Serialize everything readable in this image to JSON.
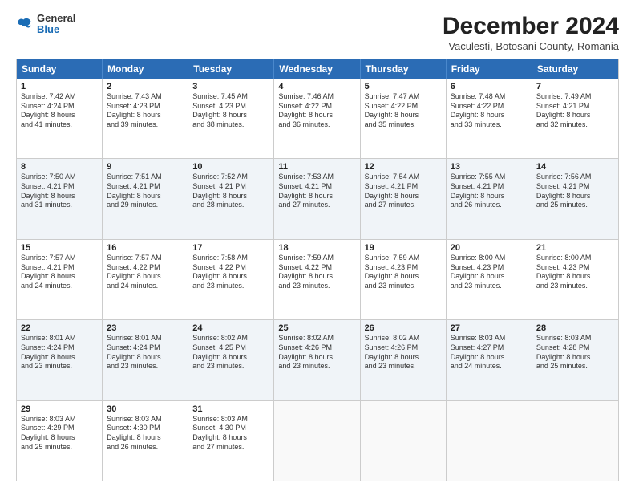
{
  "header": {
    "logo_general": "General",
    "logo_blue": "Blue",
    "month_title": "December 2024",
    "subtitle": "Vaculesti, Botosani County, Romania"
  },
  "days_of_week": [
    "Sunday",
    "Monday",
    "Tuesday",
    "Wednesday",
    "Thursday",
    "Friday",
    "Saturday"
  ],
  "rows": [
    [
      {
        "day": "1",
        "lines": [
          "Sunrise: 7:42 AM",
          "Sunset: 4:24 PM",
          "Daylight: 8 hours",
          "and 41 minutes."
        ]
      },
      {
        "day": "2",
        "lines": [
          "Sunrise: 7:43 AM",
          "Sunset: 4:23 PM",
          "Daylight: 8 hours",
          "and 39 minutes."
        ]
      },
      {
        "day": "3",
        "lines": [
          "Sunrise: 7:45 AM",
          "Sunset: 4:23 PM",
          "Daylight: 8 hours",
          "and 38 minutes."
        ]
      },
      {
        "day": "4",
        "lines": [
          "Sunrise: 7:46 AM",
          "Sunset: 4:22 PM",
          "Daylight: 8 hours",
          "and 36 minutes."
        ]
      },
      {
        "day": "5",
        "lines": [
          "Sunrise: 7:47 AM",
          "Sunset: 4:22 PM",
          "Daylight: 8 hours",
          "and 35 minutes."
        ]
      },
      {
        "day": "6",
        "lines": [
          "Sunrise: 7:48 AM",
          "Sunset: 4:22 PM",
          "Daylight: 8 hours",
          "and 33 minutes."
        ]
      },
      {
        "day": "7",
        "lines": [
          "Sunrise: 7:49 AM",
          "Sunset: 4:21 PM",
          "Daylight: 8 hours",
          "and 32 minutes."
        ]
      }
    ],
    [
      {
        "day": "8",
        "lines": [
          "Sunrise: 7:50 AM",
          "Sunset: 4:21 PM",
          "Daylight: 8 hours",
          "and 31 minutes."
        ]
      },
      {
        "day": "9",
        "lines": [
          "Sunrise: 7:51 AM",
          "Sunset: 4:21 PM",
          "Daylight: 8 hours",
          "and 29 minutes."
        ]
      },
      {
        "day": "10",
        "lines": [
          "Sunrise: 7:52 AM",
          "Sunset: 4:21 PM",
          "Daylight: 8 hours",
          "and 28 minutes."
        ]
      },
      {
        "day": "11",
        "lines": [
          "Sunrise: 7:53 AM",
          "Sunset: 4:21 PM",
          "Daylight: 8 hours",
          "and 27 minutes."
        ]
      },
      {
        "day": "12",
        "lines": [
          "Sunrise: 7:54 AM",
          "Sunset: 4:21 PM",
          "Daylight: 8 hours",
          "and 27 minutes."
        ]
      },
      {
        "day": "13",
        "lines": [
          "Sunrise: 7:55 AM",
          "Sunset: 4:21 PM",
          "Daylight: 8 hours",
          "and 26 minutes."
        ]
      },
      {
        "day": "14",
        "lines": [
          "Sunrise: 7:56 AM",
          "Sunset: 4:21 PM",
          "Daylight: 8 hours",
          "and 25 minutes."
        ]
      }
    ],
    [
      {
        "day": "15",
        "lines": [
          "Sunrise: 7:57 AM",
          "Sunset: 4:21 PM",
          "Daylight: 8 hours",
          "and 24 minutes."
        ]
      },
      {
        "day": "16",
        "lines": [
          "Sunrise: 7:57 AM",
          "Sunset: 4:22 PM",
          "Daylight: 8 hours",
          "and 24 minutes."
        ]
      },
      {
        "day": "17",
        "lines": [
          "Sunrise: 7:58 AM",
          "Sunset: 4:22 PM",
          "Daylight: 8 hours",
          "and 23 minutes."
        ]
      },
      {
        "day": "18",
        "lines": [
          "Sunrise: 7:59 AM",
          "Sunset: 4:22 PM",
          "Daylight: 8 hours",
          "and 23 minutes."
        ]
      },
      {
        "day": "19",
        "lines": [
          "Sunrise: 7:59 AM",
          "Sunset: 4:23 PM",
          "Daylight: 8 hours",
          "and 23 minutes."
        ]
      },
      {
        "day": "20",
        "lines": [
          "Sunrise: 8:00 AM",
          "Sunset: 4:23 PM",
          "Daylight: 8 hours",
          "and 23 minutes."
        ]
      },
      {
        "day": "21",
        "lines": [
          "Sunrise: 8:00 AM",
          "Sunset: 4:23 PM",
          "Daylight: 8 hours",
          "and 23 minutes."
        ]
      }
    ],
    [
      {
        "day": "22",
        "lines": [
          "Sunrise: 8:01 AM",
          "Sunset: 4:24 PM",
          "Daylight: 8 hours",
          "and 23 minutes."
        ]
      },
      {
        "day": "23",
        "lines": [
          "Sunrise: 8:01 AM",
          "Sunset: 4:24 PM",
          "Daylight: 8 hours",
          "and 23 minutes."
        ]
      },
      {
        "day": "24",
        "lines": [
          "Sunrise: 8:02 AM",
          "Sunset: 4:25 PM",
          "Daylight: 8 hours",
          "and 23 minutes."
        ]
      },
      {
        "day": "25",
        "lines": [
          "Sunrise: 8:02 AM",
          "Sunset: 4:26 PM",
          "Daylight: 8 hours",
          "and 23 minutes."
        ]
      },
      {
        "day": "26",
        "lines": [
          "Sunrise: 8:02 AM",
          "Sunset: 4:26 PM",
          "Daylight: 8 hours",
          "and 23 minutes."
        ]
      },
      {
        "day": "27",
        "lines": [
          "Sunrise: 8:03 AM",
          "Sunset: 4:27 PM",
          "Daylight: 8 hours",
          "and 24 minutes."
        ]
      },
      {
        "day": "28",
        "lines": [
          "Sunrise: 8:03 AM",
          "Sunset: 4:28 PM",
          "Daylight: 8 hours",
          "and 25 minutes."
        ]
      }
    ],
    [
      {
        "day": "29",
        "lines": [
          "Sunrise: 8:03 AM",
          "Sunset: 4:29 PM",
          "Daylight: 8 hours",
          "and 25 minutes."
        ]
      },
      {
        "day": "30",
        "lines": [
          "Sunrise: 8:03 AM",
          "Sunset: 4:30 PM",
          "Daylight: 8 hours",
          "and 26 minutes."
        ]
      },
      {
        "day": "31",
        "lines": [
          "Sunrise: 8:03 AM",
          "Sunset: 4:30 PM",
          "Daylight: 8 hours",
          "and 27 minutes."
        ]
      },
      {
        "day": "",
        "lines": []
      },
      {
        "day": "",
        "lines": []
      },
      {
        "day": "",
        "lines": []
      },
      {
        "day": "",
        "lines": []
      }
    ]
  ]
}
